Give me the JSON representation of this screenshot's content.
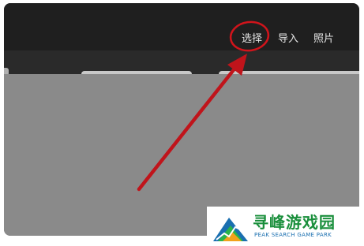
{
  "toolbar": {
    "select_label": "选择",
    "import_label": "导入",
    "photos_label": "照片"
  },
  "annotation": {
    "color": "#d0141b",
    "target": "select"
  },
  "watermark": {
    "title": "寻峰游戏园",
    "subtitle": "PEAK SEARCH GAME PARK"
  },
  "colors": {
    "topbar": "#1f1f1f",
    "content": "#8a8a8a",
    "watermark_green": "#1a8f3c",
    "watermark_blue": "#1a6fb0"
  }
}
